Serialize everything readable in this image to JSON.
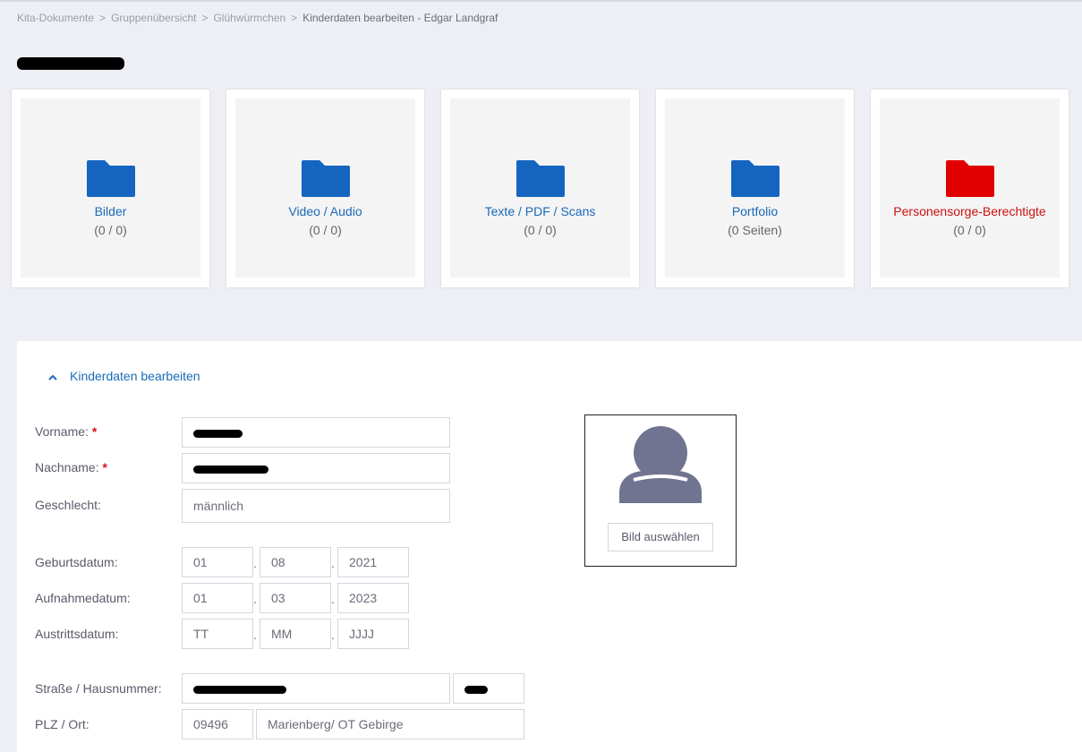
{
  "breadcrumb": {
    "items": [
      "Kita-Dokumente",
      "Gruppenübersicht",
      "Glühwürmchen"
    ],
    "current": "Kinderdaten bearbeiten - Edgar Landgraf",
    "separator": ">"
  },
  "cards": [
    {
      "title": "Bilder",
      "count": "(0 / 0)",
      "icon": "folder-icon",
      "color": "#1565c0"
    },
    {
      "title": "Video / Audio",
      "count": "(0 / 0)",
      "icon": "folder-icon",
      "color": "#1565c0"
    },
    {
      "title": "Texte / PDF / Scans",
      "count": "(0 / 0)",
      "icon": "folder-icon",
      "color": "#1565c0"
    },
    {
      "title": "Portfolio",
      "count": "(0 Seiten)",
      "icon": "folder-icon",
      "color": "#1565c0"
    },
    {
      "title": "Personensorge-Berechtigte",
      "count": "(0 / 0)",
      "icon": "folder-icon",
      "color": "#e00000"
    }
  ],
  "form": {
    "section_title": "Kinderdaten bearbeiten",
    "section_icon": "chevron-up-icon",
    "required_marker": "*",
    "labels": {
      "vorname": "Vorname:",
      "nachname": "Nachname:",
      "geschlecht": "Geschlecht:",
      "geburtsdatum": "Geburtsdatum:",
      "aufnahmedatum": "Aufnahmedatum:",
      "austrittsdatum": "Austrittsdatum:",
      "strasse": "Straße / Hausnummer:",
      "plz_ort": "PLZ / Ort:"
    },
    "values": {
      "geschlecht": "männlich",
      "geburtsdatum": {
        "tt": "01",
        "mm": "08",
        "jjjj": "2021"
      },
      "aufnahmedatum": {
        "tt": "01",
        "mm": "03",
        "jjjj": "2023"
      },
      "austrittsdatum": {
        "tt": "TT",
        "mm": "MM",
        "jjjj": "JJJJ"
      },
      "plz": "09496",
      "ort": "Marienberg/ OT Gebirge"
    },
    "date_separator": "."
  },
  "photo": {
    "button_label": "Bild auswählen",
    "avatar_icon": "avatar-placeholder-icon",
    "avatar_color": "#717490"
  }
}
